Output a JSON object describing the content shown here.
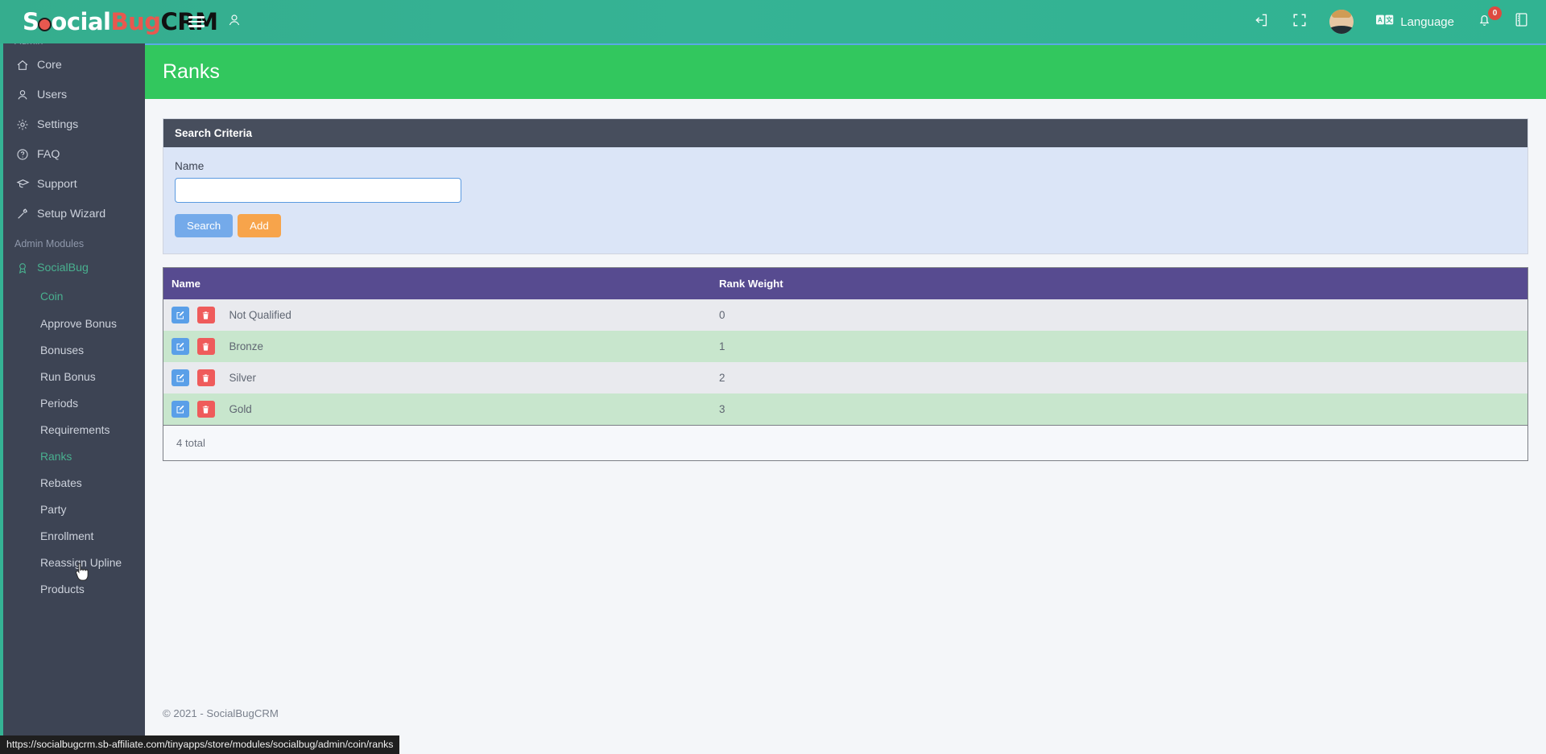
{
  "brand": {
    "part1": "S",
    "part2": "ocial",
    "part3": "Bug",
    "part4": "CRM"
  },
  "topbar": {
    "menu_toggle": "menu-toggle",
    "user_icon": "user",
    "logout_label": "logout",
    "fullscreen_label": "fullscreen",
    "avatar_label": "account avatar",
    "language_label": "Language",
    "notifications_count": "0",
    "book_label": "docs"
  },
  "sidebar": {
    "section_admin": "Admin",
    "items": [
      {
        "label": "Core",
        "icon": "home-icon"
      },
      {
        "label": "Users",
        "icon": "user-icon"
      },
      {
        "label": "Settings",
        "icon": "gear-icon"
      },
      {
        "label": "FAQ",
        "icon": "question-circle-icon"
      },
      {
        "label": "Support",
        "icon": "graduation-cap-icon"
      },
      {
        "label": "Setup Wizard",
        "icon": "magic-wand-icon"
      }
    ],
    "section_modules": "Admin Modules",
    "module": {
      "label": "SocialBug",
      "icon": "award-icon"
    },
    "group": "Coin",
    "links": [
      {
        "label": "Approve Bonus",
        "active": false
      },
      {
        "label": "Bonuses",
        "active": false
      },
      {
        "label": "Run Bonus",
        "active": false
      },
      {
        "label": "Periods",
        "active": false
      },
      {
        "label": "Requirements",
        "active": false
      },
      {
        "label": "Ranks",
        "active": true
      },
      {
        "label": "Rebates",
        "active": false
      },
      {
        "label": "Party",
        "active": false
      },
      {
        "label": "Enrollment",
        "active": false
      },
      {
        "label": "Reassign Upline",
        "active": false
      },
      {
        "label": "Products",
        "active": false
      }
    ]
  },
  "page": {
    "title": "Ranks"
  },
  "search_panel": {
    "title": "Search Criteria",
    "name_label": "Name",
    "name_value": "",
    "name_placeholder": "",
    "search_button": "Search",
    "add_button": "Add"
  },
  "table": {
    "columns": [
      "Name",
      "Rank Weight"
    ],
    "rows": [
      {
        "name": "Not Qualified",
        "weight": "0"
      },
      {
        "name": "Bronze",
        "weight": "1"
      },
      {
        "name": "Silver",
        "weight": "2"
      },
      {
        "name": "Gold",
        "weight": "3"
      }
    ],
    "total": "4 total",
    "edit_icon": "edit-icon",
    "delete_icon": "trash-icon"
  },
  "footer": {
    "copyright": "© 2021 - SocialBugCRM"
  },
  "statusbar": {
    "url": "https://socialbugcrm.sb-affiliate.com/tinyapps/store/modules/socialbug/admin/coin/ranks"
  },
  "colors": {
    "topbar": "#35b394",
    "sidebar": "#3d4454",
    "page_header_green": "#32c75e",
    "panel_header": "#474e5d",
    "panel_body": "#dbe5f7",
    "table_header": "#574b90",
    "row_odd": "#e9eaee",
    "row_even": "#c8e6cd",
    "accent_green": "#49b08f",
    "btn_search": "#74aaea",
    "btn_add": "#f7a44b",
    "edit_blue": "#5a9fe8",
    "delete_red": "#ef5b5b",
    "badge_red": "#e8453c"
  }
}
